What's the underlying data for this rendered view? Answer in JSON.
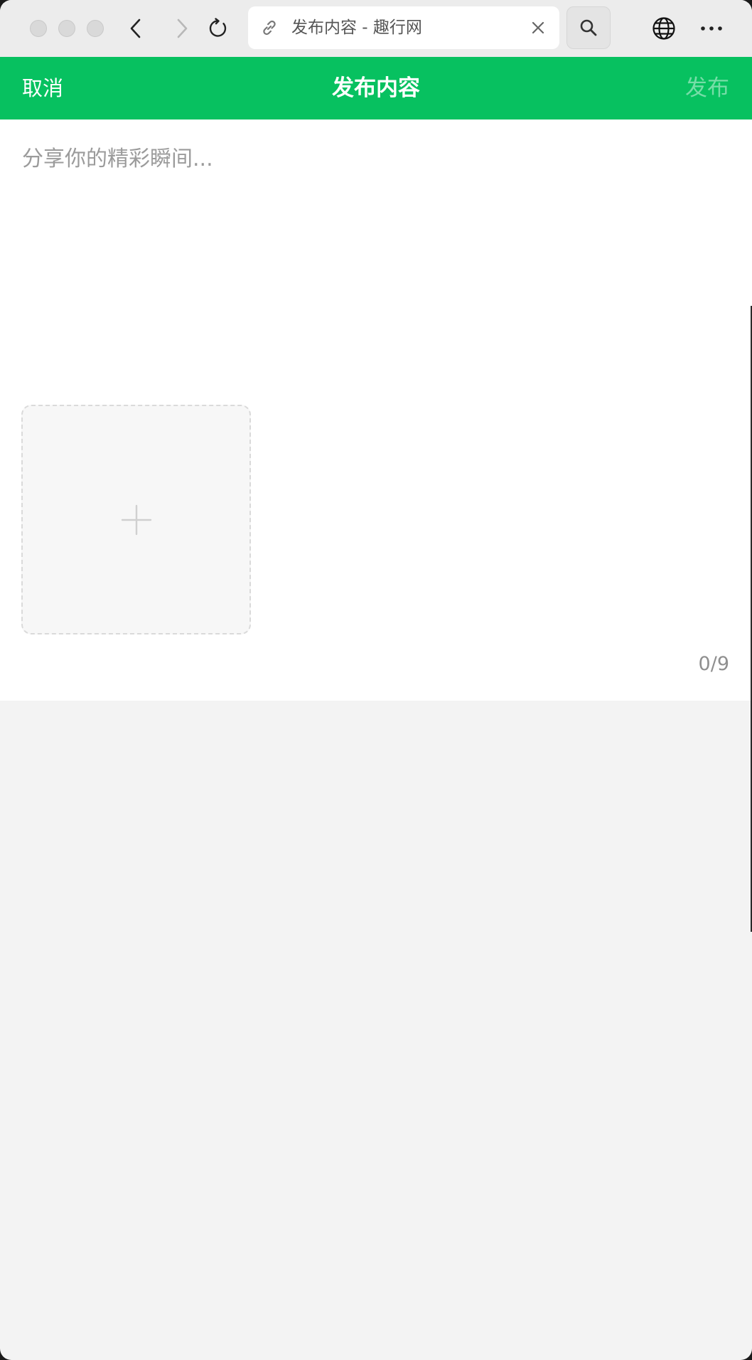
{
  "browser": {
    "tab_title": "发布内容 - 趣行网"
  },
  "header": {
    "cancel_label": "取消",
    "title": "发布内容",
    "publish_label": "发布"
  },
  "compose": {
    "placeholder": "分享你的精彩瞬间...",
    "value": "",
    "image_count": "0/9"
  },
  "colors": {
    "brand": "#07c160",
    "page_bg": "#f3f3f3"
  }
}
